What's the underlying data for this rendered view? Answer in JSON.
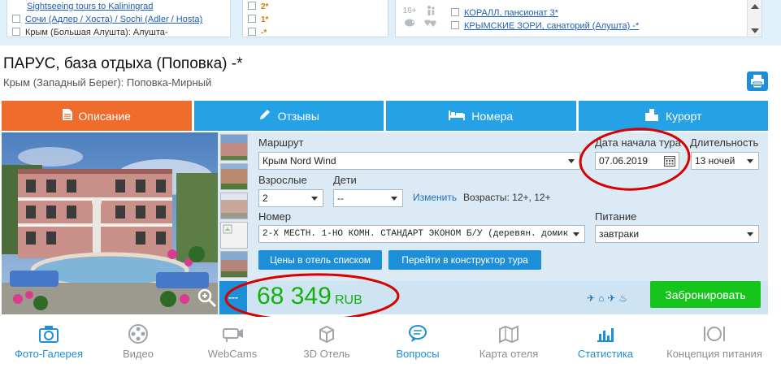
{
  "filters": {
    "col1": [
      {
        "text": "Sightseeing tours to Kaliningrad",
        "link": true,
        "checkbox": false
      },
      {
        "text": "Сочи (Адлер / Хоста) / Sochi (Adler / Hosta)",
        "link": true,
        "checkbox": true
      },
      {
        "text": "Крым (Большая Алушта): Алушта-",
        "link": false,
        "checkbox": true
      }
    ],
    "col2": [
      {
        "text": "2*"
      },
      {
        "text": "1*"
      },
      {
        "text": "-*"
      }
    ],
    "col3_icons": [
      "16+",
      "child-icon",
      "pig-icon",
      "hearts-icon"
    ],
    "col3_items": [
      {
        "text": ""
      },
      {
        "text": "КОРАЛЛ, пансионат 3*"
      },
      {
        "text": "КРЫМСКИЕ ЗОРИ, санаторий (Алушта) -*"
      }
    ]
  },
  "hotel": {
    "title": "ПАРУС, база отдыха (Поповка) -*",
    "location": "Крым (Западный Берег): Поповка-Мирный"
  },
  "tabs": [
    {
      "label": "Описание",
      "icon": "document-icon",
      "active": true
    },
    {
      "label": "Отзывы",
      "icon": "pencil-icon",
      "active": false
    },
    {
      "label": "Номера",
      "icon": "bed-icon",
      "active": false
    },
    {
      "label": "Курорт",
      "icon": "city-icon",
      "active": false
    }
  ],
  "form": {
    "route_label": "Маршрут",
    "route_value": "Крым Nord Wind",
    "date_label": "Дата начала тура",
    "date_value": "07.06.2019",
    "duration_label": "Длительность",
    "duration_value": "13 ночей",
    "adults_label": "Взрослые",
    "adults_value": "2",
    "children_label": "Дети",
    "children_value": "--",
    "change_link": "Изменить",
    "ages_text": "Возрасты: 12+, 12+",
    "room_label": "Номер",
    "room_value": "2-Х МЕСТН. 1-НО КОМН. СТАНДАРТ ЭКОНОМ Б/У (деревян. домик",
    "meal_label": "Питание",
    "meal_value": "завтраки",
    "btn_prices": "Цены в отель списком",
    "btn_constructor": "Перейти в конструктор тура"
  },
  "price": {
    "side_label": "---",
    "value": "68 349",
    "currency": "RUB",
    "book_label": "Забронировать",
    "service_icons": [
      "plane-icon",
      "house-icon",
      "plane-icon",
      "food-icon"
    ]
  },
  "features": [
    {
      "label": "Фото-Галерея",
      "icon": "camera-icon",
      "active": true
    },
    {
      "label": "Видео",
      "icon": "film-icon",
      "active": false
    },
    {
      "label": "WebCams",
      "icon": "webcam-icon",
      "active": false
    },
    {
      "label": "3D Отель",
      "icon": "cube-icon",
      "active": false
    },
    {
      "label": "Вопросы",
      "icon": "chat-icon",
      "active": true
    },
    {
      "label": "Карта отеля",
      "icon": "map-icon",
      "active": false
    },
    {
      "label": "Статистика",
      "icon": "chart-icon",
      "active": true
    },
    {
      "label": "Концепция питания",
      "icon": "dish-icon",
      "active": false
    }
  ],
  "colors": {
    "accent": "#25a2e6",
    "active_tab": "#f06c2c",
    "price": "#13b10b",
    "book": "#17c41b",
    "annotation": "#d80000"
  }
}
